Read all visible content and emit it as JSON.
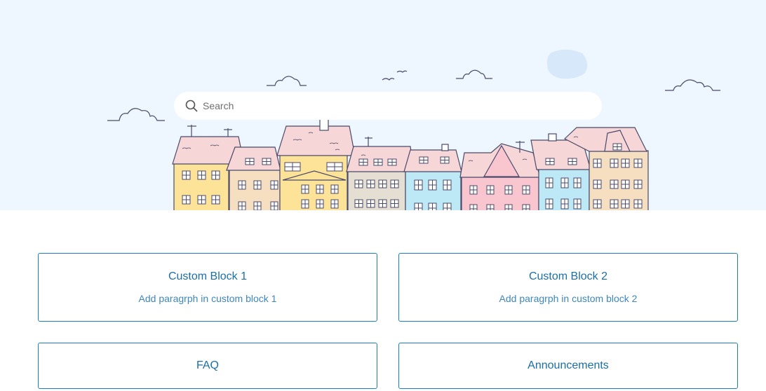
{
  "search": {
    "placeholder": "Search"
  },
  "blocks": [
    {
      "title": "Custom Block 1",
      "description": "Add paragrph in custom block 1"
    },
    {
      "title": "Custom Block 2",
      "description": "Add paragrph in custom block 2"
    },
    {
      "title": "FAQ"
    },
    {
      "title": "Announcements"
    }
  ],
  "colors": {
    "hero_background": "#eef6ff",
    "accent": "#1a7fc1",
    "house_yellow": "#fde398",
    "house_pink": "#f9c6cf",
    "house_blue": "#bde8f6",
    "house_beige": "#f6dfc0",
    "roof_pink": "#f6d6d6"
  },
  "icons": [
    "search-icon",
    "cloud-icon",
    "bird-icon",
    "moon-icon",
    "houses-illustration"
  ]
}
